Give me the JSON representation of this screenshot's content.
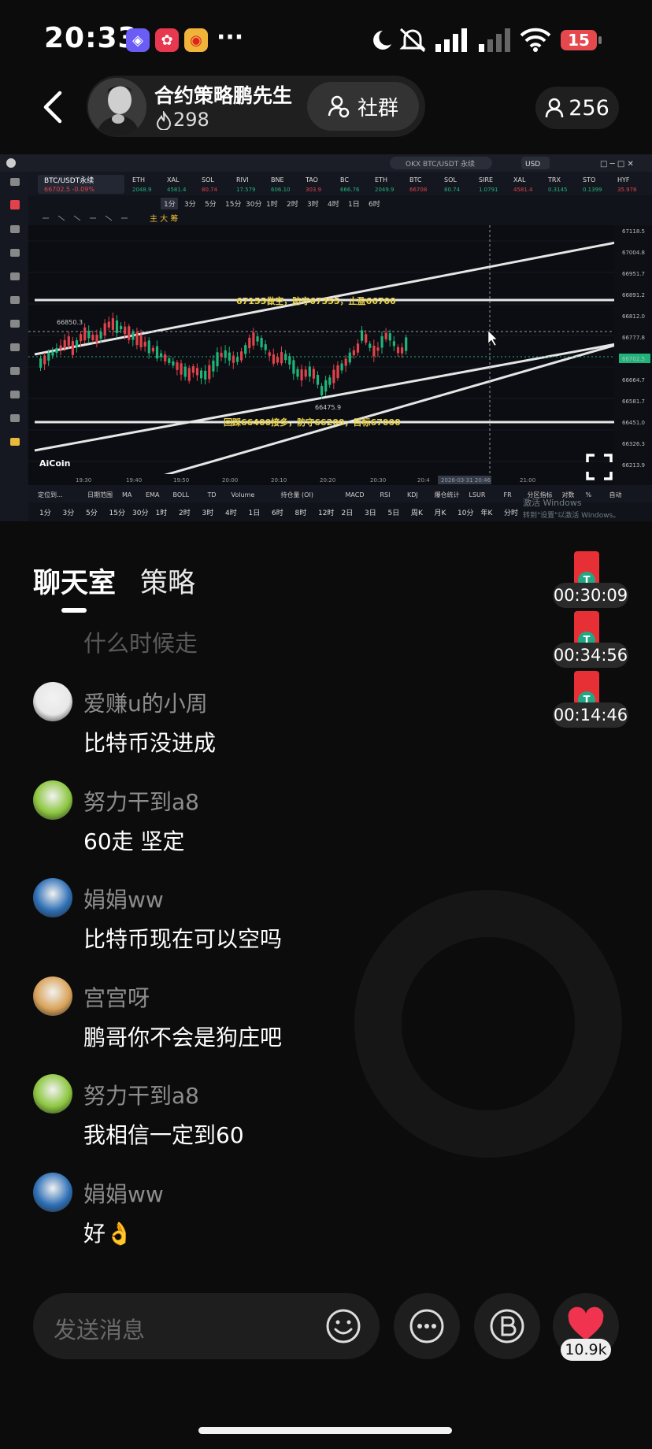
{
  "status_bar": {
    "time": "20:33",
    "more": "···",
    "battery": "15"
  },
  "header": {
    "host_name": "合约策略鹏先生",
    "host_likes": "298",
    "group_label": "社群",
    "viewer_count": "256"
  },
  "chart_screen": {
    "pair_label": "BTC/USDT永续",
    "pair_price": "66702.5  -0.09%",
    "search_text": "OKX BTC/USDT 永续",
    "currency": "USD",
    "tickers": [
      {
        "name": "ETH",
        "value": "2048.9"
      },
      {
        "name": "XAL",
        "value": "4581.4"
      },
      {
        "name": "SOL",
        "value": "80.74"
      },
      {
        "name": "RIVI",
        "value": "17.579"
      },
      {
        "name": "BNE",
        "value": "606.10"
      },
      {
        "name": "TAO",
        "value": "303.9"
      },
      {
        "name": "BC",
        "value": "666.76"
      },
      {
        "name": "ETH",
        "value": "2049.9"
      },
      {
        "name": "BTC",
        "value": "66708"
      },
      {
        "name": "SOL",
        "value": "80.74"
      },
      {
        "name": "SIRE",
        "value": "1.0791"
      },
      {
        "name": "XAL",
        "value": "4581.4"
      },
      {
        "name": "TRX",
        "value": "0.3145"
      },
      {
        "name": "STO",
        "value": "0.1399"
      },
      {
        "name": "HYF",
        "value": "35.978"
      }
    ],
    "interval_tabs": [
      "1分",
      "3分",
      "5分",
      "15分",
      "30分",
      "1时",
      "2时",
      "3时",
      "4时",
      "1日",
      "6时"
    ],
    "annotation_top": "67155做空，防守67355，止盈66700",
    "annotation_bottom": "回踩66400接多，防守66200，目标67000",
    "high_label": "66850.3",
    "low_label": "66475.9",
    "logo": "AiCoin",
    "time_labels": [
      "19:30",
      "19:40",
      "19:50",
      "20:00",
      "20:10",
      "20:20",
      "20:30",
      "20:4",
      "2026-03-31 20:46",
      "21:00"
    ],
    "price_labels": [
      "67118.5",
      "67004.8",
      "66951.7",
      "66891.2",
      "66812.0",
      "66777.8",
      "66702.5",
      "66664.7",
      "66581.7",
      "66451.0",
      "66326.3",
      "66213.9"
    ],
    "indicator_tabs": [
      "定位到...",
      "日期范围",
      "MA",
      "EMA",
      "BOLL",
      "TD",
      "Volume",
      "持仓量 (OI)",
      "MACD",
      "RSI",
      "KDJ",
      "爆仓统计",
      "LSUR",
      "FR",
      "分区指标",
      "对数",
      "%",
      "自动"
    ],
    "bottom_intervals": [
      "1分",
      "3分",
      "5分",
      "15分",
      "30分",
      "1时",
      "2时",
      "3时",
      "4时",
      "1日",
      "6时",
      "8时",
      "12时",
      "2日",
      "3日",
      "5日",
      "周K",
      "月K",
      "10分",
      "年K",
      "分时"
    ],
    "watermark_1": "激活 Windows",
    "watermark_2": "转到\"设置\"以激活 Windows。"
  },
  "chat_tabs": {
    "active": "聊天室",
    "other": "策略"
  },
  "red_packets": [
    {
      "time": "00:30:09",
      "coin": "T"
    },
    {
      "time": "00:34:56",
      "coin": "T"
    },
    {
      "time": "00:14:46",
      "coin": "T"
    }
  ],
  "faded_message": "什么时候走",
  "messages": [
    {
      "name": "爱赚u的小周",
      "text": "比特币没进成",
      "avatar_color": "#e8e8e8"
    },
    {
      "name": "努力干到a8",
      "text": "60走 坚定",
      "avatar_color": "#8cc63f"
    },
    {
      "name": "娟娟ww",
      "text": "比特币现在可以空吗",
      "avatar_color": "#2e6fb5"
    },
    {
      "name": "宫宫呀",
      "text": "鹏哥你不会是狗庄吧",
      "avatar_color": "#d9a35a"
    },
    {
      "name": "努力干到a8",
      "text": "我相信一定到60",
      "avatar_color": "#8cc63f"
    },
    {
      "name": "娟娟ww",
      "text": "好👌",
      "avatar_color": "#2e6fb5"
    }
  ],
  "bottom_bar": {
    "input_placeholder": "发送消息",
    "like_count": "10.9k"
  },
  "colors": {
    "up": "#1fb47a",
    "down": "#e2424b",
    "annotation": "#e9d34a",
    "like": "#f0334f"
  }
}
